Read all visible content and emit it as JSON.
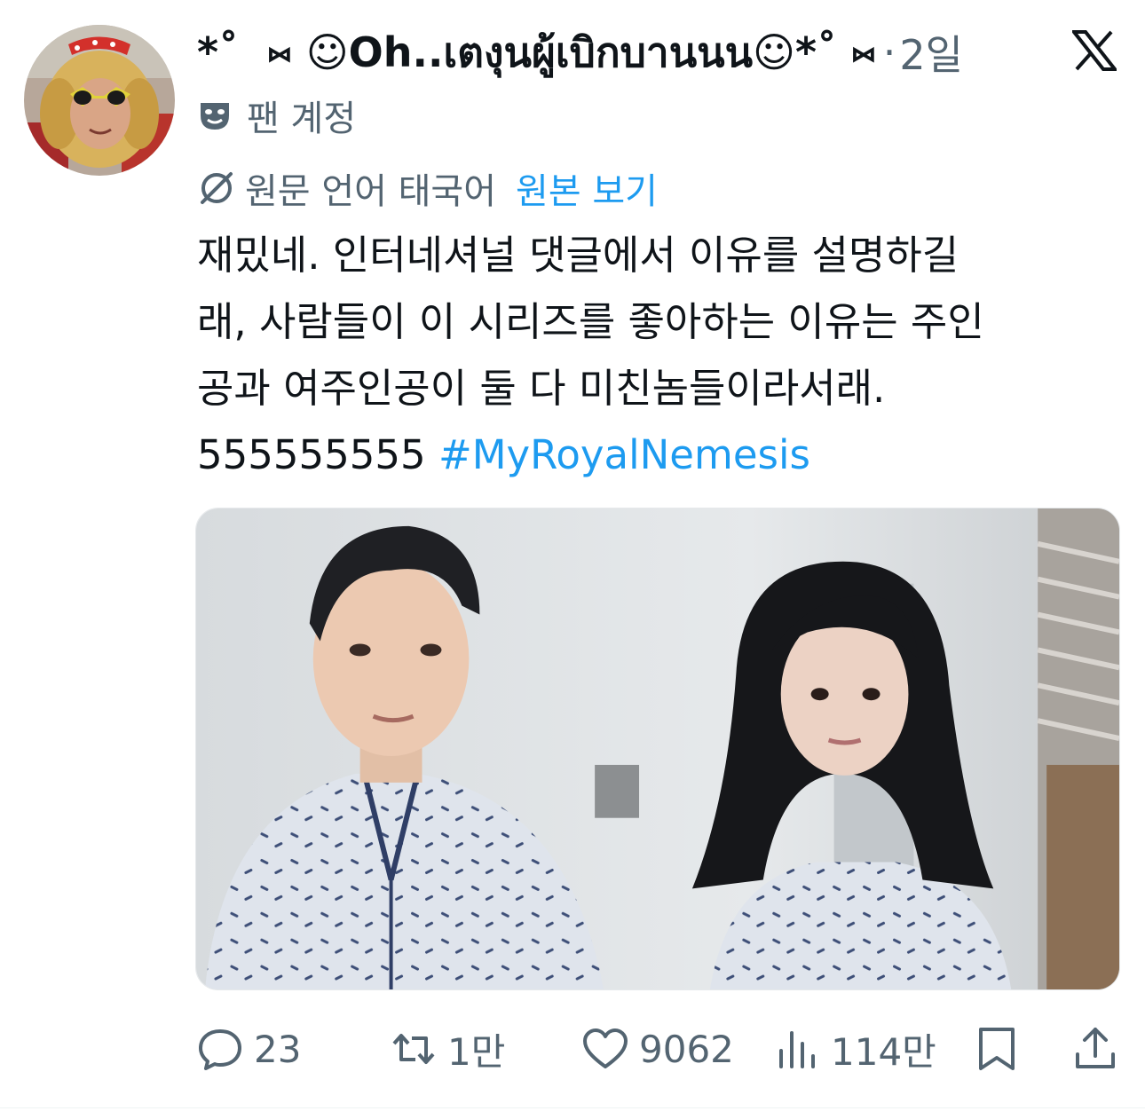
{
  "author": {
    "display_name": "*˚ ͏ ⑅ ☺Oh..เตงุนผู้เบิกบานนน☺*˚ ⑅",
    "timestamp": "2일",
    "dot": "·",
    "badge_label": "팬 계정"
  },
  "translation": {
    "label": "원문 언어 태국어",
    "show_original": "원본 보기"
  },
  "tweet": {
    "line1": "재밌네. 인터네셔널 댓글에서 이유를 설명하길",
    "line2": "래, 사람들이 이 시리즈를 좋아하는 이유는 주인",
    "line3": "공과 여주인공이 둘 다 미친놈들이라서래.",
    "line4_text": "555555555 ",
    "hashtag": "#MyRoyalNemesis"
  },
  "actions": {
    "replies": "23",
    "reposts": "1만",
    "likes": "9062",
    "views": "114만"
  },
  "icons": {
    "brand": "x-logo-icon",
    "fan": "theater-mask-icon",
    "translate": "translate-icon",
    "reply": "reply-icon",
    "repost": "repost-icon",
    "like": "heart-icon",
    "views": "views-chart-icon",
    "bookmark": "bookmark-icon",
    "share": "share-icon"
  },
  "colors": {
    "text": "#0f1419",
    "muted": "#536471",
    "link": "#1d9bf0"
  }
}
